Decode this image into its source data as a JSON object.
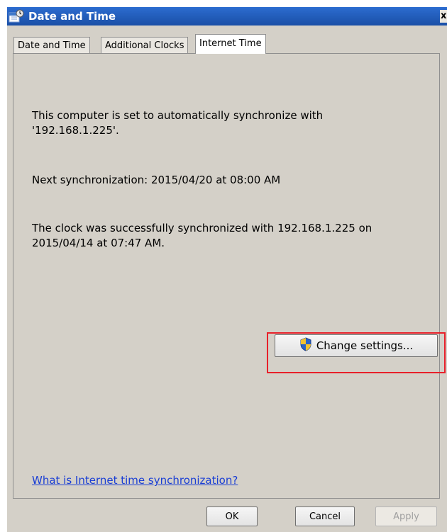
{
  "window": {
    "title": "Date and Time",
    "close_label": "x"
  },
  "tabs": [
    {
      "label": "Date and Time",
      "active": false
    },
    {
      "label": "Additional Clocks",
      "active": false
    },
    {
      "label": "Internet Time",
      "active": true
    }
  ],
  "content": {
    "sync_line1": "This computer is set to automatically synchronize with",
    "sync_line2": "'192.168.1.225'.",
    "next_sync": "Next synchronization: 2015/04/20 at 08:00 AM",
    "last_sync_line1": "The clock was successfully synchronized with 192.168.1.225 on",
    "last_sync_line2": "2015/04/14 at 07:47 AM.",
    "change_settings_label": "Change settings...",
    "help_link": "What is Internet time synchronization?"
  },
  "buttons": {
    "ok": "OK",
    "cancel": "Cancel",
    "apply": "Apply"
  },
  "colors": {
    "titlebar": "#1f5bb8",
    "highlight": "#e8202a",
    "link": "#1a3ed4",
    "dialog_bg": "#d4d0c8"
  },
  "icons": {
    "title": "clock-calendar-icon",
    "change_settings": "uac-shield-icon"
  }
}
